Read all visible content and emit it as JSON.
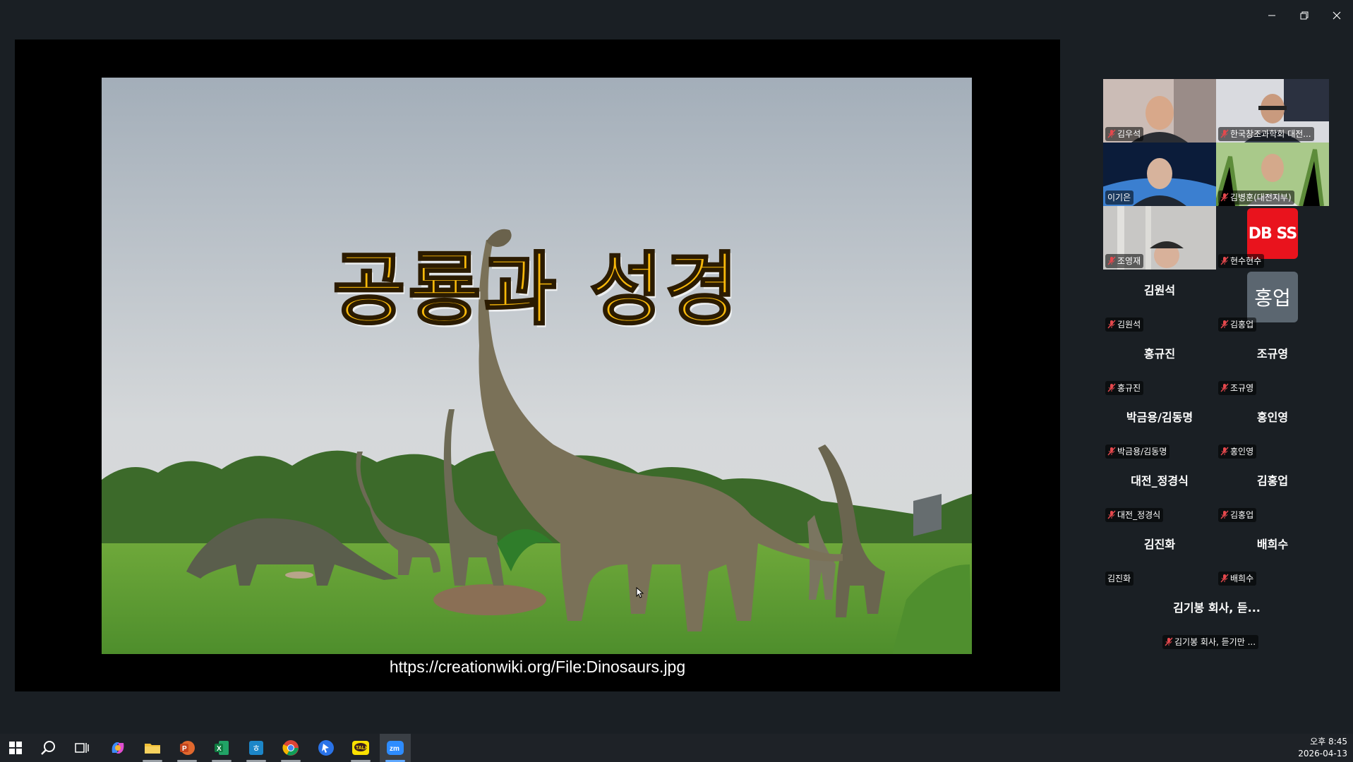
{
  "window": {
    "controls": [
      "minimize",
      "restore",
      "close"
    ]
  },
  "slide": {
    "title": "공룡과 성경",
    "caption": "https://creationwiki.org/File:Dinosaurs.jpg"
  },
  "participants": {
    "video_tiles": [
      {
        "name": "김우석",
        "muted": true
      },
      {
        "name": "한국창조과학회 대전...",
        "muted": true
      },
      {
        "name": "이기은",
        "muted": false,
        "active": true
      },
      {
        "name": "김병훈(대전지부)",
        "muted": true
      },
      {
        "name": "조영재",
        "muted": true
      },
      {
        "name": "현수현수",
        "muted": true,
        "badge": "DB SS"
      }
    ],
    "avatar_tiles": [
      {
        "display": "김원석",
        "name": "김원석",
        "muted": true
      },
      {
        "display": "홍업",
        "name": "김홍업",
        "muted": true,
        "badge": true
      },
      {
        "display": "홍규진",
        "name": "홍규진",
        "muted": true
      },
      {
        "display": "조규영",
        "name": "조규영",
        "muted": true
      },
      {
        "display": "박금용/김동명",
        "name": "박금용/김동명",
        "muted": true
      },
      {
        "display": "홍인영",
        "name": "홍인영",
        "muted": true
      },
      {
        "display": "대전_정경식",
        "name": "대전_정경식",
        "muted": true
      },
      {
        "display": "김홍업",
        "name": "김홍업",
        "muted": true
      },
      {
        "display": "김진화",
        "name": "김진화",
        "muted": false
      },
      {
        "display": "배희수",
        "name": "배희수",
        "muted": true
      },
      {
        "display": "김기봉 회사, 듣...",
        "name": "김기봉 회사, 듣기만 ...",
        "muted": true
      }
    ]
  },
  "taskbar": {
    "apps": [
      "windows-start",
      "search",
      "task-view",
      "copilot",
      "file-explorer",
      "powerpoint",
      "excel",
      "hancom-word",
      "chrome",
      "app-blue",
      "kakaotalk",
      "zoom"
    ],
    "clock": {
      "time": "오후 8:45",
      "date": "2026-04-13"
    }
  },
  "colors": {
    "accent_active": "#27d36b",
    "muted_icon": "#e5484d",
    "title_yellow": "#f9b90a"
  }
}
